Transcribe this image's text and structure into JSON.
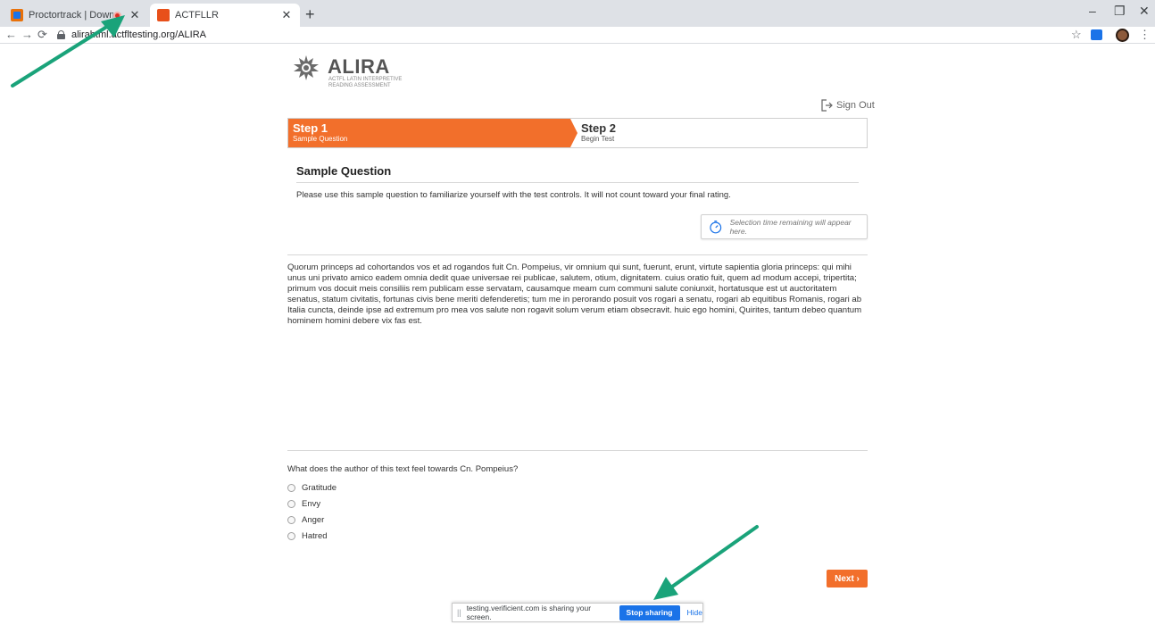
{
  "browser": {
    "tabs": [
      {
        "title": "Proctortrack | Download",
        "favicon": "proctortrack-favicon",
        "recording": true
      },
      {
        "title": "ACTFLLR",
        "favicon": "actfl-favicon",
        "recording": false
      }
    ],
    "url": "alirahtml.actfltesting.org/ALIRA",
    "window_controls": {
      "minimize": "–",
      "restore": "❐",
      "close": "✕"
    },
    "icons": [
      "back-icon",
      "forward-icon",
      "reload-icon",
      "lock-icon",
      "star-icon",
      "extension-icon",
      "profile-avatar",
      "menu-icon"
    ]
  },
  "header": {
    "logo_title": "ALIRA",
    "logo_subtitle": "ACTFL LATIN INTERPRETIVE READING ASSESSMENT",
    "sign_out": "Sign Out"
  },
  "steps": [
    {
      "title": "Step 1",
      "subtitle": "Sample Question",
      "active": true
    },
    {
      "title": "Step 2",
      "subtitle": "Begin Test",
      "active": false
    }
  ],
  "sample": {
    "title": "Sample Question",
    "description": "Please use this sample question to familiarize yourself with the test controls. It will not count toward your final rating.",
    "timer_text": "Selection time remaining will appear here."
  },
  "passage": "Quorum princeps ad cohortandos vos et ad rogandos fuit Cn. Pompeius, vir omnium qui sunt, fuerunt, erunt, virtute sapientia gloria princeps: qui mihi unus uni privato amico eadem omnia dedit quae universae rei publicae, salutem, otium, dignitatem. cuius oratio fuit, quem ad modum accepi, tripertita; primum vos docuit meis consiliis rem publicam esse servatam, causamque meam cum communi salute coniunxit, hortatusque est ut auctoritatem senatus, statum civitatis, fortunas civis bene meriti defenderetis; tum me in perorando posuit vos rogari a senatu, rogari ab equitibus Romanis, rogari ab Italia cuncta, deinde ipse ad extremum pro mea vos salute non rogavit solum verum etiam obsecravit. huic ego homini, Quirites, tantum debeo quantum hominem homini debere vix fas est.",
  "question": {
    "prompt": "What does the author of this text feel towards Cn. Pompeius?",
    "options": [
      "Gratitude",
      "Envy",
      "Anger",
      "Hatred"
    ]
  },
  "next_button": "Next ›",
  "share_bar": {
    "grip": "||",
    "message": "testing.verificient.com is sharing your screen.",
    "stop_button": "Stop sharing",
    "hide_link": "Hide"
  },
  "colors": {
    "accent": "#f26f2b",
    "annotation_arrow": "#1aa37a",
    "share_button": "#1a73e8"
  }
}
